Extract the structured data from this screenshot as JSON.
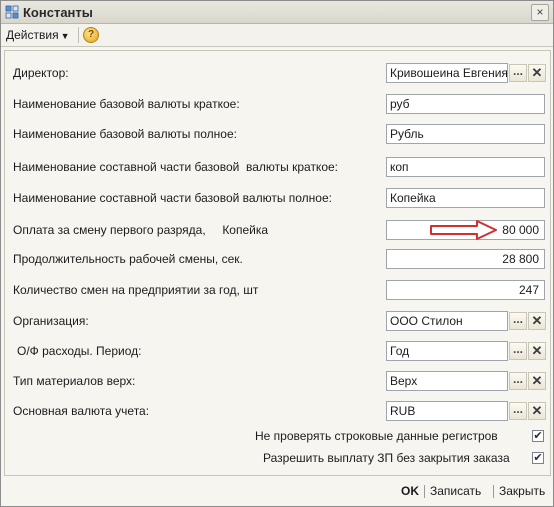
{
  "window": {
    "title": "Константы"
  },
  "toolbar": {
    "actions_label": "Действия",
    "help_symbol": "?"
  },
  "rows": [
    {
      "label": "Директор:",
      "value": "Кривошеина Евгения",
      "type": "ref"
    },
    {
      "label": "Наименование базовой валюты краткое:",
      "value": "руб",
      "type": "text"
    },
    {
      "label": "Наименование базовой валюты полное:",
      "value": "Рубль",
      "type": "text"
    },
    {
      "label": "Наименование составной части базовой  валюты краткое:",
      "value": "коп",
      "type": "text"
    },
    {
      "label": "Наименование составной части базовой валюты полное:",
      "value": "Копейка",
      "type": "text"
    },
    {
      "label": "Оплата за смену первого разряда,     Копейка",
      "value": "80 000",
      "type": "number"
    },
    {
      "label": "Продолжительность рабочей смены, сек.",
      "value": "28 800",
      "type": "number"
    },
    {
      "label": "Количество смен на предприятии за год, шт",
      "value": "247",
      "type": "number"
    },
    {
      "label": "Организация:",
      "value": "ООО Стилон",
      "type": "ref"
    },
    {
      "label": "О/Ф расходы. Период:",
      "value": "Год",
      "type": "ref"
    },
    {
      "label": "Тип материалов верх:",
      "value": "Верх",
      "type": "ref"
    },
    {
      "label": "Основная валюта учета:",
      "value": "RUB",
      "type": "ref"
    }
  ],
  "checkboxes": [
    {
      "label": "Не проверять строковые данные регистров",
      "checked": true
    },
    {
      "label": "Разрешить выплату ЗП без закрытия заказа",
      "checked": true
    }
  ],
  "footer": {
    "ok": "OK",
    "save": "Записать",
    "close": "Закрыть"
  },
  "icons": {
    "select": "...",
    "clear": "✕",
    "check": "✔",
    "close": "×"
  },
  "colors": {
    "annotation_arrow": "#d32f2f"
  }
}
